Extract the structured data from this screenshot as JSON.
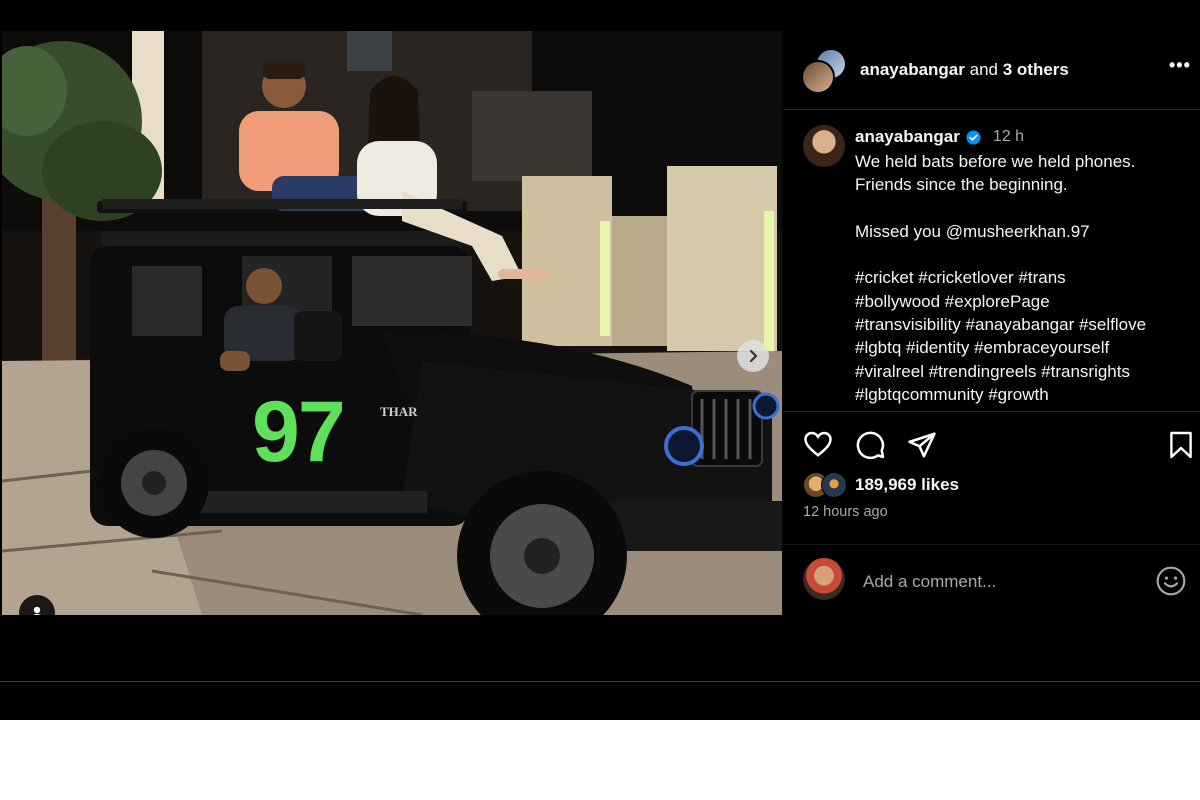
{
  "header": {
    "username": "anayabangar",
    "and_text": "and",
    "others": "3 others",
    "more_label": "•••"
  },
  "caption": {
    "username": "anayabangar",
    "time": "12 h",
    "lines": [
      "We held bats before we held phones.",
      "Friends since the beginning."
    ],
    "mention_line": "Missed you @musheerkhan.97",
    "hashtag_lines": [
      "#cricket #cricketlover #trans",
      "#bollywood #explorePage",
      "#transvisibility #anayabangar #selflove",
      "#lgbtq #identity #embraceyourself",
      "#viralreel #trendingreels #transrights",
      "#lgbtqcommunity #growth"
    ]
  },
  "stats": {
    "likes": "189,969 likes",
    "time_ago": "12 hours ago"
  },
  "comment": {
    "placeholder": "Add a comment..."
  },
  "photo": {
    "jersey_number": "97",
    "car_badge": "THAR",
    "carousel_count": 3,
    "carousel_active": 0
  },
  "colors": {
    "background": "#000000",
    "verified": "#0095f6",
    "text_primary": "#f5f5f5",
    "text_secondary": "#a8a8a8",
    "jersey_green": "#5fe05a"
  },
  "icons": [
    "more-icon",
    "verified-icon",
    "heart-icon",
    "comment-icon",
    "share-icon",
    "bookmark-icon",
    "emoji-icon",
    "next-arrow-icon",
    "user-tag-icon"
  ]
}
